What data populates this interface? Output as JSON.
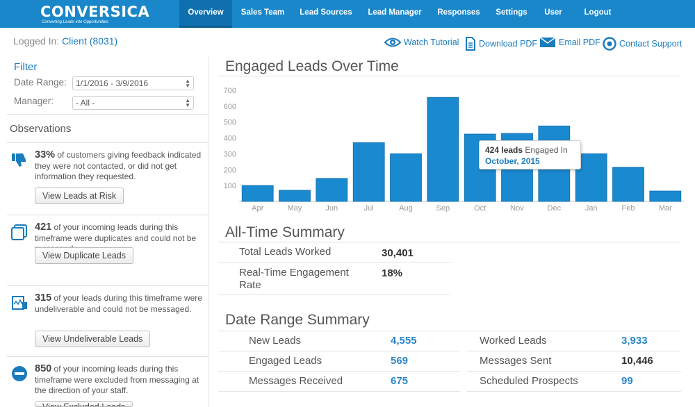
{
  "nav": {
    "logo": "CONVERSICA",
    "tagline": "Converting Leads into Opportunities",
    "items": [
      {
        "label": "Overview",
        "active": true
      },
      {
        "label": "Sales Team",
        "active": false
      },
      {
        "label": "Lead Sources",
        "active": false
      },
      {
        "label": "Lead Manager",
        "active": false
      },
      {
        "label": "Responses",
        "active": false
      },
      {
        "label": "Settings",
        "active": false
      },
      {
        "label": "User",
        "active": false
      },
      {
        "label": "Logout",
        "active": false
      }
    ]
  },
  "header": {
    "logged_in_label": "Logged In:",
    "client": "Client (8031)",
    "actions": [
      {
        "label": "Watch Tutorial",
        "icon": "eye-icon"
      },
      {
        "label": "Download PDF",
        "icon": "document-icon"
      },
      {
        "label": "Email PDF",
        "icon": "envelope-icon"
      },
      {
        "label": "Contact Support",
        "icon": "support-icon"
      }
    ]
  },
  "filter": {
    "title": "Filter",
    "date_range_label": "Date Range:",
    "date_range_value": "1/1/2016 - 3/9/2016",
    "manager_label": "Manager:",
    "manager_value": "- All -"
  },
  "observations": {
    "title": "Observations",
    "items": [
      {
        "icon": "thumbs-down-icon",
        "number": "33%",
        "text": "of customers giving feedback indicated they were not contacted, or did not get information they requested.",
        "button": "View Leads at Risk"
      },
      {
        "icon": "duplicate-icon",
        "number": "421",
        "text": "of your incoming leads during this timeframe were duplicates and could not be messaged.",
        "button": "View Duplicate Leads"
      },
      {
        "icon": "undeliverable-icon",
        "number": "315",
        "text": "of your leads during this timeframe were undeliverable and could not be messaged.",
        "button": "View Undeliverable Leads"
      },
      {
        "icon": "minus-circle-icon",
        "number": "850",
        "text": "of your incoming leads during this timeframe were excluded from messaging at the direction of your staff.",
        "button": "View Excluded Leads"
      }
    ]
  },
  "engaged": {
    "title": "Engaged Leads Over Time",
    "tooltip": {
      "leads": "424 leads",
      "engaged": "Engaged In",
      "month": "October, 2015"
    }
  },
  "chart_data": {
    "type": "bar",
    "title": "Engaged Leads Over Time",
    "categories": [
      "Apr",
      "May",
      "Jun",
      "Jul",
      "Aug",
      "Sep",
      "Oct",
      "Nov",
      "Dec",
      "Jan",
      "Feb",
      "Mar"
    ],
    "values": [
      100,
      70,
      145,
      370,
      300,
      655,
      424,
      428,
      475,
      300,
      215,
      65
    ],
    "ylim": [
      0,
      700
    ],
    "yticks": [
      100,
      200,
      300,
      400,
      500,
      600,
      700
    ],
    "grid": false,
    "color": "#1a8ad0"
  },
  "all_time": {
    "title": "All-Time Summary",
    "rows": [
      {
        "label": "Total Leads Worked",
        "value": "30,401"
      },
      {
        "label": "Real-Time Engagement Rate",
        "value": "18%"
      }
    ]
  },
  "date_range": {
    "title": "Date Range Summary",
    "rows": [
      {
        "label": "New Leads",
        "value": "4,555",
        "label2": "Worked Leads",
        "value2": "3,933"
      },
      {
        "label": "Engaged Leads",
        "value": "569",
        "label2": "Messages Sent",
        "value2": "10,446"
      },
      {
        "label": "Messages Received",
        "value": "675",
        "label2": "Scheduled Prospects",
        "value2": "99"
      }
    ]
  }
}
